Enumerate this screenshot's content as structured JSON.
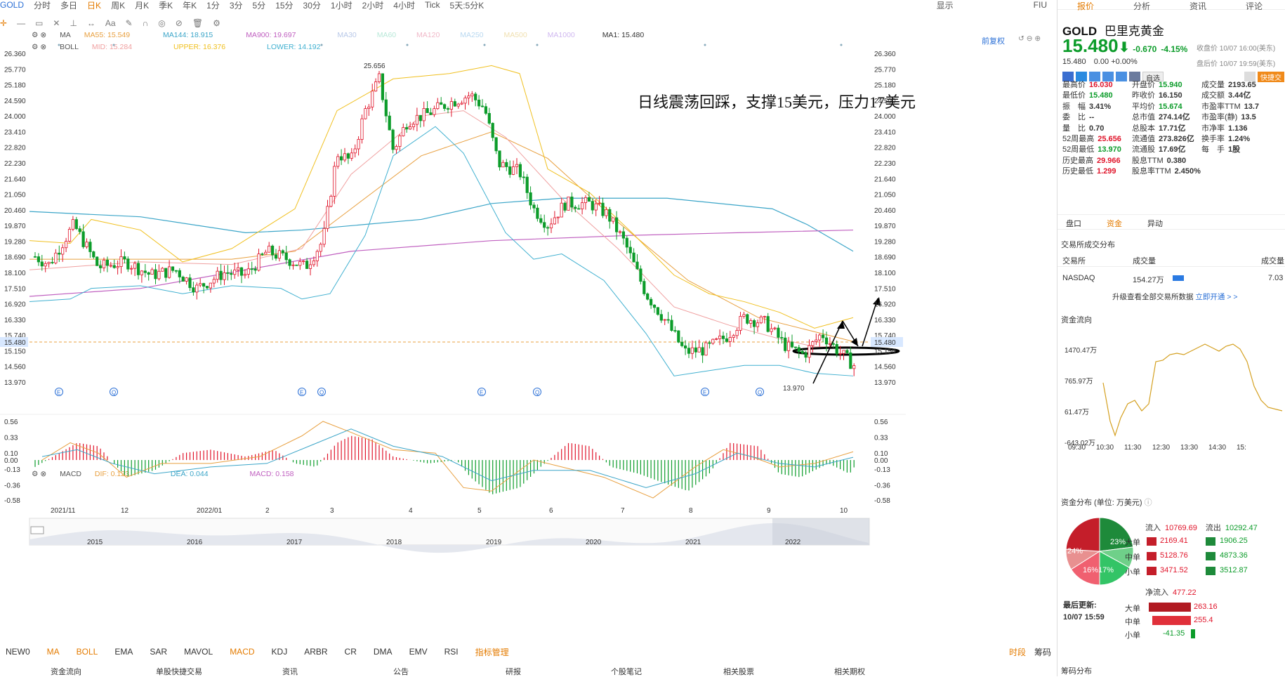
{
  "topbar": {
    "items": [
      "GOLD",
      "分时",
      "多日",
      "日K",
      "周K",
      "月K",
      "季K",
      "年K",
      "1分",
      "3分",
      "5分",
      "15分",
      "30分",
      "1小时",
      "2小时",
      "4小时",
      "Tick",
      "5天:5分K"
    ],
    "active": "日K",
    "right": [
      "显示",
      "FIU"
    ]
  },
  "indicators": {
    "ma": {
      "label": "MA",
      "ma55": "MA55: 15.549",
      "ma144": "MA144: 18.915",
      "ma900": "MA900: 19.697",
      "ma30": "MA30",
      "ma60": "MA60",
      "ma120": "MA120",
      "ma250": "MA250",
      "ma500": "MA500",
      "ma1000": "MA1000",
      "ma1": "MA1: 15.480"
    },
    "boll": {
      "label": "BOLL",
      "mid": "MID: 15.284",
      "upper": "UPPER: 16.376",
      "lower": "LOWER: 14.192"
    },
    "macd": {
      "label": "MACD",
      "dif": "DIF: 0.123",
      "dea": "DEA: 0.044",
      "macd": "MACD: 0.158"
    },
    "fuquan": "前复权"
  },
  "annotation": "日线震荡回踩，支撑15美元，压力17美元",
  "price_axis": [
    "26.360",
    "25.770",
    "25.180",
    "24.590",
    "24.000",
    "23.410",
    "22.820",
    "22.230",
    "21.640",
    "21.050",
    "20.460",
    "19.870",
    "19.280",
    "18.690",
    "18.100",
    "17.510",
    "16.920",
    "16.330",
    "15.740",
    "15.150",
    "14.560",
    "13.970"
  ],
  "current_price_tag": "15.480",
  "high_label": "25.656",
  "low_label": "13.970",
  "macd_axis": [
    "0.56",
    "0.33",
    "0.10",
    "0.00",
    "-0.13",
    "-0.36",
    "-0.58"
  ],
  "time_axis": [
    "2021/11",
    "12",
    "2022/01",
    "2",
    "3",
    "4",
    "5",
    "6",
    "7",
    "8",
    "9",
    "10"
  ],
  "overview_axis": [
    "2015",
    "2016",
    "2017",
    "2018",
    "2019",
    "2020",
    "2021",
    "2022"
  ],
  "bottombar": [
    "NEW0",
    "MA",
    "BOLL",
    "EMA",
    "SAR",
    "MAVOL",
    "MACD",
    "KDJ",
    "ARBR",
    "CR",
    "DMA",
    "EMV",
    "RSI",
    "指标管理"
  ],
  "bottombar_right": [
    "时段",
    "筹码"
  ],
  "bottom_tabs": [
    "资金流向",
    "单股快捷交易",
    "资讯",
    "公告",
    "研报",
    "个股笔记",
    "相关股票",
    "相关期权"
  ],
  "colors": {
    "up": "#e0142a",
    "down": "#0c9c2a",
    "accent": "#e47b00",
    "ma55": "#e8a040",
    "ma144": "#3ba5c8",
    "ma900": "#c060c0",
    "upper": "#f0c020",
    "lower": "#40b0d0",
    "mid": "#f0a0a0"
  },
  "right": {
    "tabs": [
      "报价",
      "分析",
      "资讯",
      "评论"
    ],
    "symbol": "GOLD",
    "name": "巴里克黄金",
    "price": "15.480",
    "change": "-0.670",
    "pct": "-4.15%",
    "close_time": "收盘价 10/07 16:00(美东)",
    "after_label": "盘后价 10/07 19:59(美东)",
    "after_price": "15.480",
    "after_change": "0.00",
    "after_pct": "+0.00%",
    "buttons": [
      "自选",
      "快捷交"
    ],
    "stats": [
      [
        "最高价",
        "16.030",
        "开盘价",
        "15.940",
        "成交量",
        "2193.65"
      ],
      [
        "最低价",
        "15.480",
        "昨收价",
        "16.150",
        "成交额",
        "3.44亿"
      ],
      [
        "振　幅",
        "3.41%",
        "平均价",
        "15.674",
        "市盈率TTM",
        "13.7"
      ],
      [
        "委　比",
        "--",
        "总市值",
        "274.14亿",
        "市盈率(静)",
        "13.5"
      ],
      [
        "量　比",
        "0.70",
        "总股本",
        "17.71亿",
        "市净率",
        "1.136"
      ],
      [
        "52周最高",
        "25.656",
        "流通值",
        "273.826亿",
        "换手率",
        "1.24%"
      ],
      [
        "52周最低",
        "13.970",
        "流通股",
        "17.69亿",
        "每　手",
        "1股"
      ],
      [
        "历史最高",
        "29.966",
        "股息TTM",
        "0.380",
        "",
        ""
      ],
      [
        "历史最低",
        "1.299",
        "股息率TTM",
        "2.450%",
        "",
        ""
      ]
    ],
    "subtabs": [
      "盘口",
      "资金",
      "异动"
    ],
    "exchange_title": "交易所成交分布",
    "exchange_headers": [
      "交易所",
      "成交量",
      "成交量"
    ],
    "exchange_row": [
      "NASDAQ",
      "154.27万",
      "7.03"
    ],
    "upgrade": "升级查看全部交易所数据",
    "upgrade_link": "立即开通 > >",
    "flow_title": "资金流向",
    "flow_axis": [
      "1470.47万",
      "765.97万",
      "61.47万",
      "-643.02万"
    ],
    "flow_time": [
      "09:30",
      "10:30",
      "11:30",
      "12:30",
      "13:30",
      "14:30",
      "15:"
    ],
    "dist_title": "资金分布 (单位: 万美元)",
    "pie": [
      "24%",
      "23%",
      "16%",
      "17%"
    ],
    "in_label": "流入",
    "in_total": "10769.69",
    "out_label": "流出",
    "out_total": "10292.47",
    "rows": [
      [
        "大单",
        "2169.41",
        "1906.25"
      ],
      [
        "中单",
        "5128.76",
        "4873.36"
      ],
      [
        "小单",
        "3471.52",
        "3512.87"
      ]
    ],
    "net_label": "净流入",
    "net_total": "477.22",
    "last_update_label": "最后更新:",
    "last_update": "10/07 15:59",
    "net_rows": [
      [
        "大单",
        "263.16"
      ],
      [
        "中单",
        "255.4"
      ],
      [
        "小单",
        "-41.35"
      ]
    ],
    "chips": "筹码分布"
  }
}
